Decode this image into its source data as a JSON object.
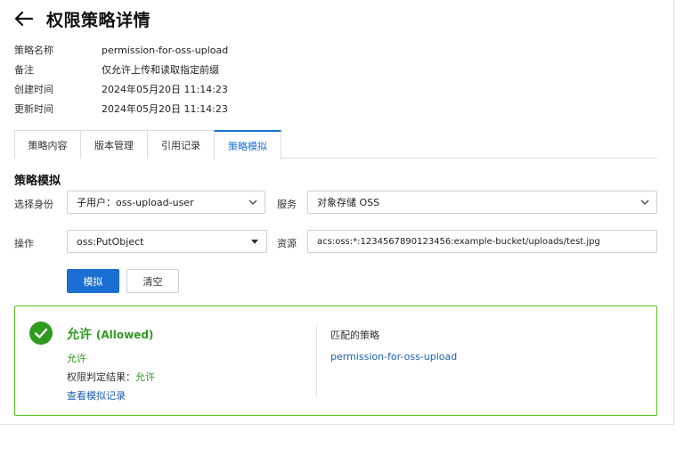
{
  "header": {
    "title": "权限策略详情"
  },
  "info": [
    {
      "label": "策略名称",
      "value": "permission-for-oss-upload"
    },
    {
      "label": "备注",
      "value": "仅允许上传和读取指定前缀"
    },
    {
      "label": "创建时间",
      "value": "2024年05月20日 11:14:23"
    },
    {
      "label": "更新时间",
      "value": "2024年05月20日 11:14:23"
    }
  ],
  "tabs": [
    {
      "label": "策略内容",
      "active": false
    },
    {
      "label": "版本管理",
      "active": false
    },
    {
      "label": "引用记录",
      "active": false
    },
    {
      "label": "策略模拟",
      "active": true
    }
  ],
  "simulation": {
    "section_title": "策略模拟",
    "identity_label": "选择身份",
    "identity_value": "子用户：oss-upload-user",
    "service_label": "服务",
    "service_value": "对象存储 OSS",
    "action_label": "操作",
    "action_value": "oss:PutObject",
    "resource_label": "资源",
    "resource_value": "acs:oss:*:1234567890123456:example-bucket/uploads/test.jpg",
    "simulate_button": "模拟",
    "clear_button": "清空"
  },
  "result": {
    "title": "允许",
    "title_en": "(Allowed)",
    "status_text": "允许",
    "decision_label": "权限判定结果：",
    "decision_value": "允许",
    "view_log_link": "查看模拟记录",
    "matched_label": "匹配的策略",
    "matched_policy": "permission-for-oss-upload"
  },
  "colors": {
    "primary": "#1a6fd3",
    "success": "#2e9b20",
    "success_border": "#52c41a",
    "link": "#1a5fb4"
  }
}
